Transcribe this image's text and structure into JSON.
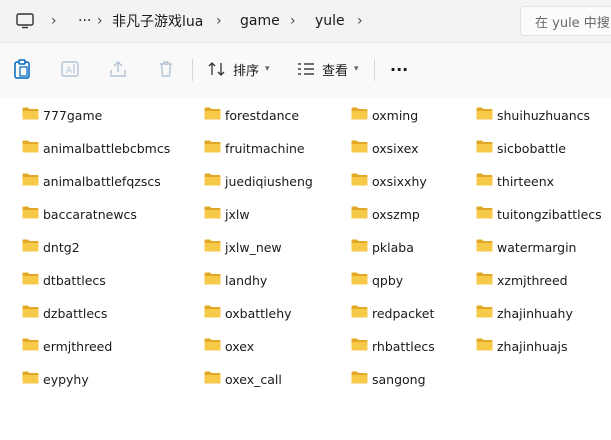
{
  "address": {
    "segments": [
      "···",
      "非凡子游戏lua",
      "game",
      "yule"
    ],
    "search_placeholder": "在 yule 中搜"
  },
  "toolbar": {
    "sort_label": "排序",
    "view_label": "查看",
    "more_label": "···"
  },
  "columns": [
    [
      "777game",
      "animalbattlebcbmcs",
      "animalbattlefqzscs",
      "baccaratnewcs",
      "dntg2",
      "dtbattlecs",
      "dzbattlecs",
      "ermjthreed",
      "eypyhy"
    ],
    [
      "forestdance",
      "fruitmachine",
      "juediqiusheng",
      "jxlw",
      "jxlw_new",
      "landhy",
      "oxbattlehy",
      "oxex",
      "oxex_call"
    ],
    [
      "oxming",
      "oxsixex",
      "oxsixxhy",
      "oxszmp",
      "pklaba",
      "qpby",
      "redpacket",
      "rhbattlecs",
      "sangong"
    ],
    [
      "shuihuzhuancs",
      "sicbobattle",
      "thirteenx",
      "tuitongzibattlecs",
      "watermargin",
      "xzmjthreed",
      "zhajinhuahy",
      "zhajinhuajs"
    ]
  ],
  "colors": {
    "folder": "#f7c948",
    "folder_dark": "#e3a926",
    "accent": "#0067c0"
  }
}
